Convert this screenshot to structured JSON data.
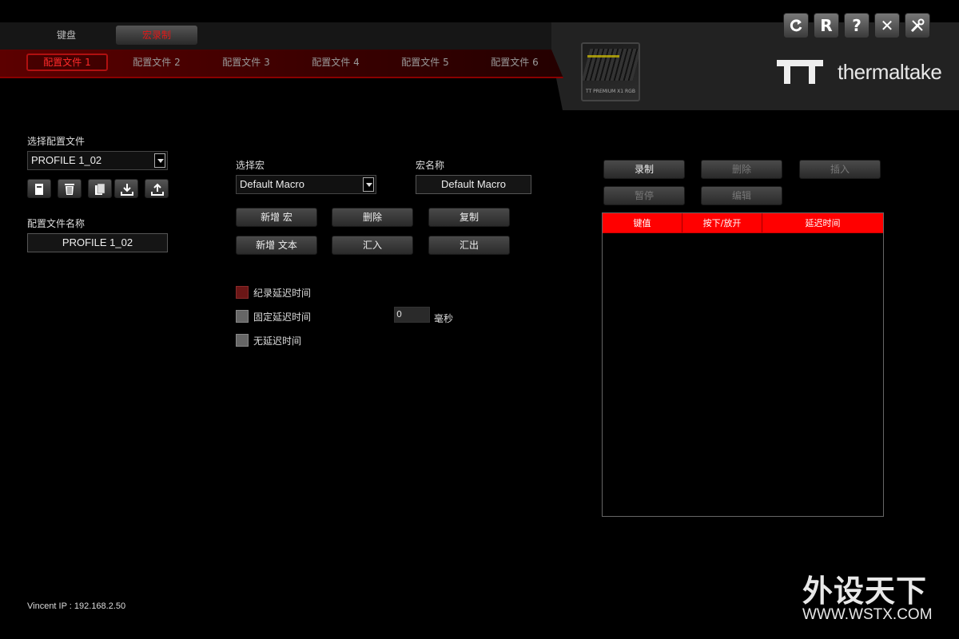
{
  "main_tabs": [
    {
      "label": "键盘",
      "active": false
    },
    {
      "label": "宏录制",
      "active": true
    }
  ],
  "profile_tabs": [
    {
      "label": "配置文件 1",
      "active": true
    },
    {
      "label": "配置文件 2",
      "active": false
    },
    {
      "label": "配置文件 3",
      "active": false
    },
    {
      "label": "配置文件 4",
      "active": false
    },
    {
      "label": "配置文件 5",
      "active": false
    },
    {
      "label": "配置文件 6",
      "active": false
    }
  ],
  "product": {
    "name": "TT PREMIUM X1 RGB"
  },
  "brand": {
    "name": "thermaltake"
  },
  "toolbar": {
    "refresh_icon": "refresh-icon",
    "r_label": "R",
    "help_label": "?",
    "close_label": "✕",
    "settings_icon": "tools-icon"
  },
  "left": {
    "select_profile_label": "选择配置文件",
    "selected_profile": "PROFILE 1_02",
    "profile_name_label": "配置文件名称",
    "profile_name_value": "PROFILE 1_02",
    "icons": [
      "new-file-icon",
      "trash-icon",
      "copy-icon",
      "import-icon",
      "export-icon"
    ]
  },
  "macro": {
    "select_macro_label": "选择宏",
    "selected_macro": "Default Macro",
    "macro_name_label": "宏名称",
    "macro_name_value": "Default Macro",
    "buttons": {
      "add_macro": "新增 宏",
      "delete": "删除",
      "copy": "复制",
      "add_text": "新增 文本",
      "import": "汇入",
      "export": "汇出"
    },
    "delay_options": [
      {
        "label": "纪录延迟时间",
        "checked": true
      },
      {
        "label": "固定延迟时间",
        "checked": false
      },
      {
        "label": "无延迟时间",
        "checked": false
      }
    ],
    "fixed_delay_value": "0",
    "fixed_delay_unit": "毫秒"
  },
  "record": {
    "buttons": {
      "record": "录制",
      "delete": "删除",
      "insert": "插入",
      "pause": "暂停",
      "edit": "编辑"
    },
    "columns": [
      "键值",
      "按下/放开",
      "延迟时间"
    ],
    "rows": []
  },
  "footer": {
    "ip": "Vincent IP : 192.168.2.50"
  },
  "watermark": {
    "cn": "外设天下",
    "url": "WWW.WSTX.COM"
  },
  "colors": {
    "accent": "#ff0000",
    "active_text": "#ff2a2a",
    "band": "#5c0000"
  }
}
